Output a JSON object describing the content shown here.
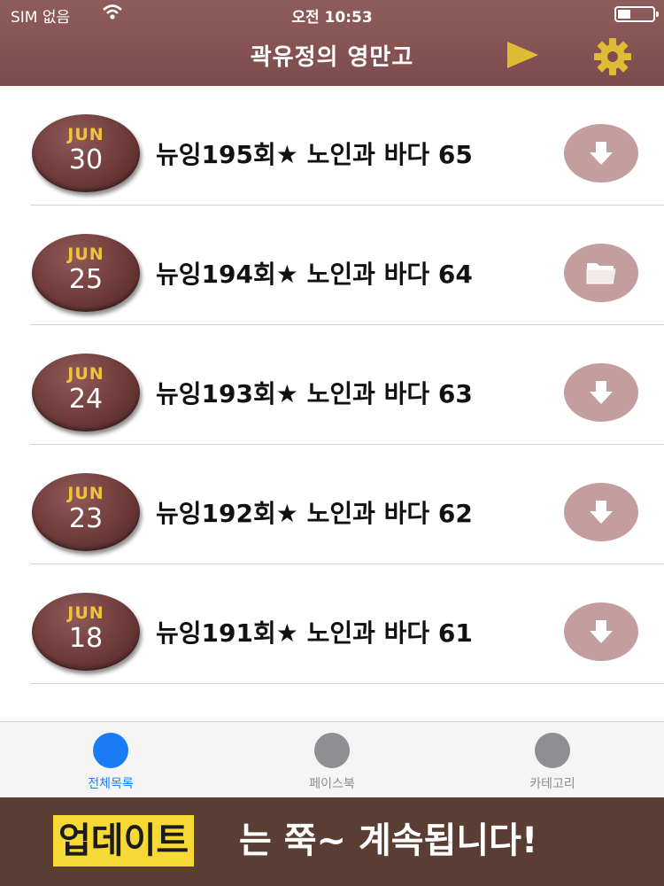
{
  "status_bar": {
    "carrier": "SIM 없음",
    "time": "오전 10:53"
  },
  "nav": {
    "title": "곽유정의 영만고",
    "play_icon": "play-icon",
    "settings_icon": "gear-icon"
  },
  "colors": {
    "header": "#7e4c4c",
    "badge": "#6e3b3a",
    "badge_month": "#f0c33a",
    "action_button": "#c49e9f",
    "tab_active": "#1a7cf5",
    "tab_inactive": "#8e8e93",
    "banner_bg": "#5a3d33",
    "banner_highlight": "#f7d936"
  },
  "episodes": [
    {
      "month": "JUN",
      "day": "30",
      "title": "뉴잉195회★ 노인과 바다 65",
      "action": "download-icon"
    },
    {
      "month": "JUN",
      "day": "25",
      "title": "뉴잉194회★ 노인과 바다 64",
      "action": "folder-icon"
    },
    {
      "month": "JUN",
      "day": "24",
      "title": "뉴잉193회★ 노인과 바다 63",
      "action": "download-icon"
    },
    {
      "month": "JUN",
      "day": "23",
      "title": "뉴잉192회★ 노인과 바다 62",
      "action": "download-icon"
    },
    {
      "month": "JUN",
      "day": "18",
      "title": "뉴잉191회★ 노인과 바다 61",
      "action": "download-icon"
    }
  ],
  "tabs": [
    {
      "label": "전체목록",
      "active": true
    },
    {
      "label": "페이스북",
      "active": false
    },
    {
      "label": "카테고리",
      "active": false
    }
  ],
  "banner": {
    "highlight": "업데이트",
    "text": "는 쭉~ 계속됩니다!"
  }
}
